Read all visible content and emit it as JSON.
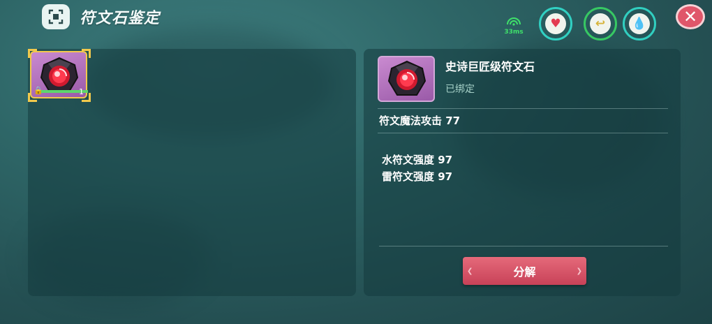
{
  "header": {
    "title": "符文石鉴定",
    "ping": "33ms"
  },
  "inventory": {
    "slots": [
      {
        "icon": "red-rune-stone-icon",
        "count": "1",
        "locked": true,
        "selected": true
      }
    ]
  },
  "detail": {
    "name": "史诗巨匠级符文石",
    "bind_state": "已绑定",
    "main_stat": "符文魔法攻击 77",
    "sub_stats": [
      "水符文强度 97",
      "雷符文强度 97"
    ],
    "action_label": "分解"
  },
  "colors": {
    "accent_gold": "#f2c94c",
    "button_red": "#d9566a",
    "epic_purple": "#b574c0",
    "ping_green": "#3fe06a"
  }
}
